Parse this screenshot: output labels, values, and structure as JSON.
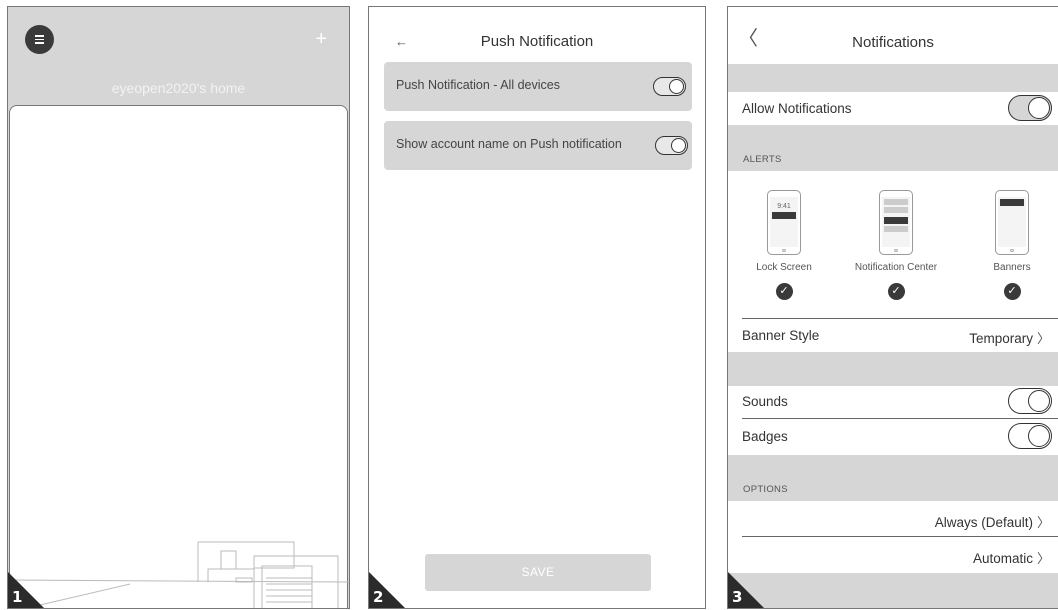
{
  "steps": {
    "one": "1",
    "two": "2",
    "three": "3"
  },
  "screen1": {
    "home_title": "eyeopen2020's home",
    "plus_label": "+",
    "icons": {
      "menu": "menu-icon",
      "add": "plus-icon",
      "illustration": "house-illustration"
    }
  },
  "screen2": {
    "back_label": "←",
    "title": "Push Notification",
    "rows": [
      {
        "label": "Push Notification - All devices",
        "toggle_on": true
      },
      {
        "label": "Show account name on Push notification",
        "toggle_on": true
      }
    ],
    "save_label": "SAVE"
  },
  "screen3": {
    "back_label": "〈",
    "title": "Notifications",
    "allow_label": "Allow Notifications",
    "allow_on": true,
    "alerts_header": "ALERTS",
    "alerts": [
      {
        "label": "Lock Screen",
        "time": "9:41",
        "checked": true
      },
      {
        "label": "Notification Center",
        "checked": true
      },
      {
        "label": "Banners",
        "checked": true
      }
    ],
    "check_glyph": "✓",
    "banner_style_label": "Banner Style",
    "banner_style_value": "Temporary",
    "sounds_label": "Sounds",
    "sounds_on": false,
    "badges_label": "Badges",
    "badges_on": false,
    "options_header": "OPTIONS",
    "preview_value": "Always (Default)",
    "grouping_value": "Automatic",
    "chevron": "〉"
  }
}
